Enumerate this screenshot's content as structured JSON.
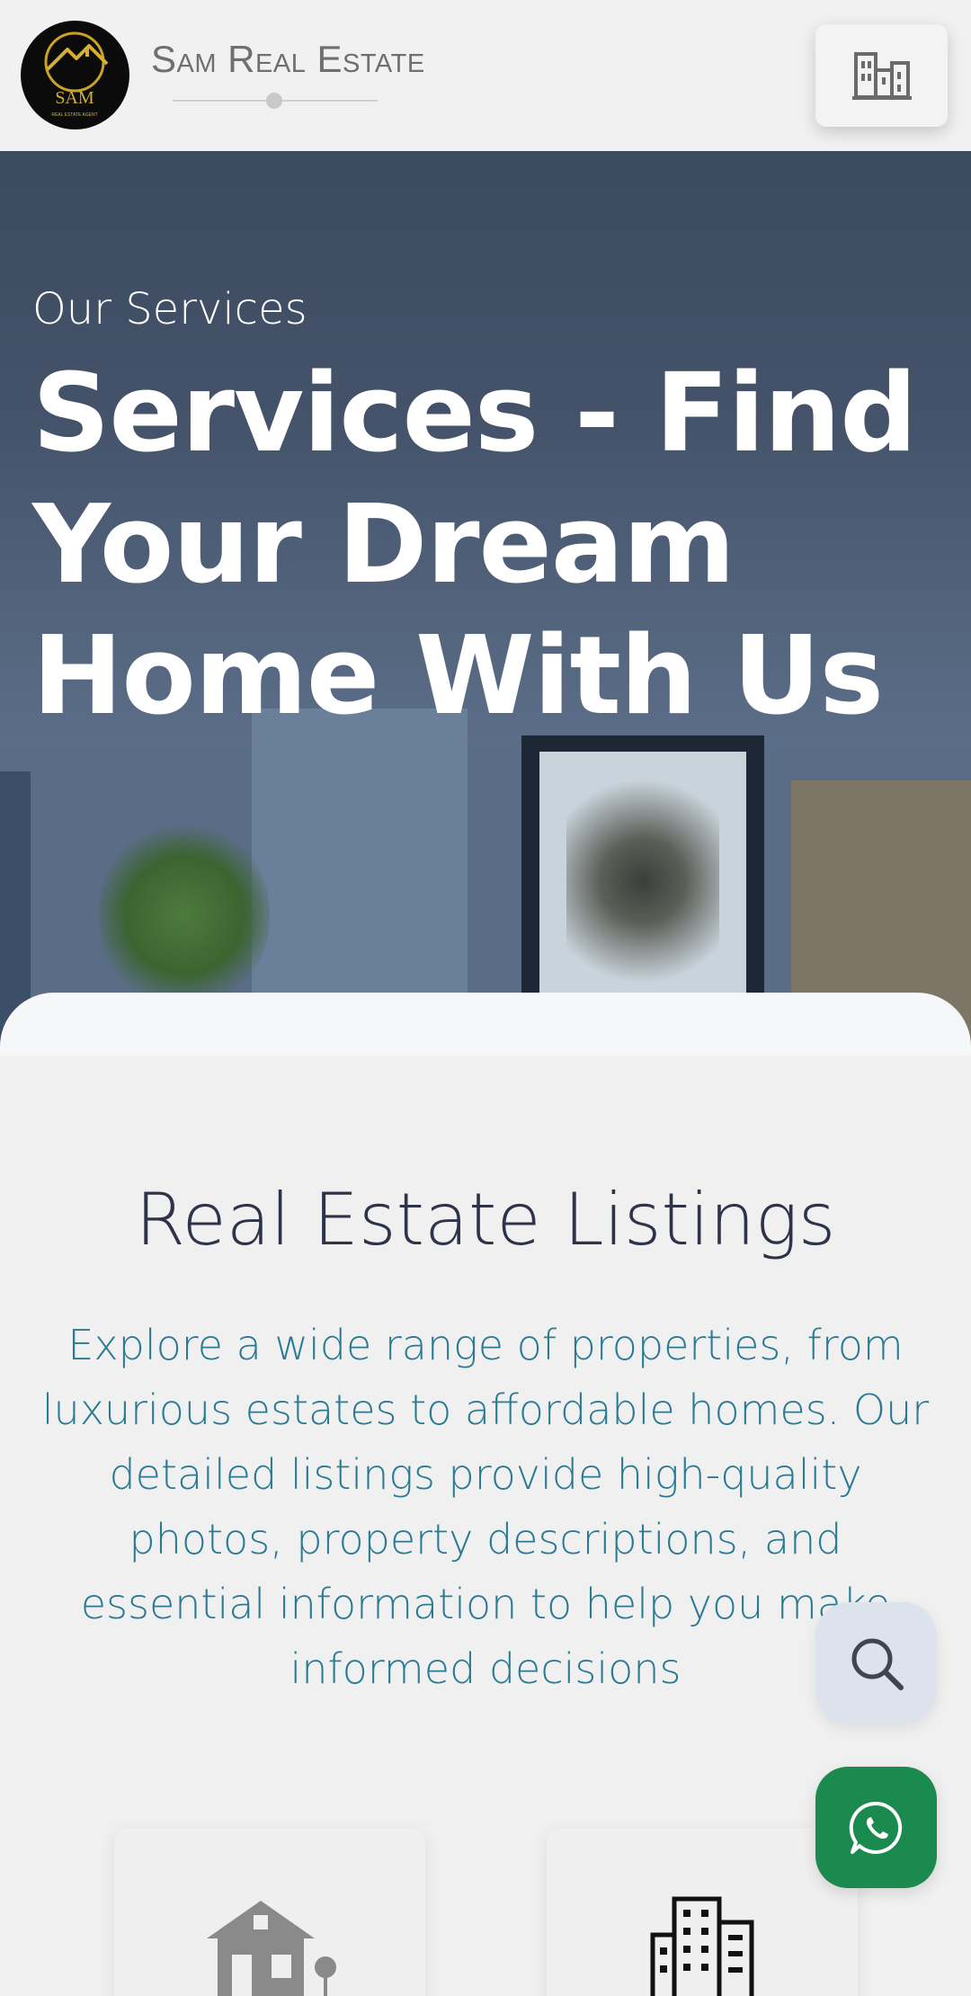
{
  "header": {
    "brand_name": "Sam Real Estate",
    "logo_icon": "house-roof-logo",
    "logo_text": "SAM",
    "logo_subtext": "REAL ESTATE AGENT",
    "menu_icon": "buildings-icon"
  },
  "hero": {
    "subtitle": "Our Services",
    "title": "Services - Find Your Dream Home With Us"
  },
  "listings": {
    "title": "Real Estate Listings",
    "description": "Explore a wide range of properties, from luxurious estates to affordable homes. Our detailed listings provide high-quality photos, property descriptions, and essential information to help you make informed decisions"
  },
  "floating": {
    "search_icon": "search-icon",
    "whatsapp_icon": "whatsapp-icon"
  },
  "cards": [
    {
      "icon": "house-icon"
    },
    {
      "icon": "apartment-building-icon"
    }
  ],
  "colors": {
    "header_bg": "#f1f1f1",
    "hero_overlay": "#3c4a5e",
    "section_title": "#2e3349",
    "section_text": "#2a7a93",
    "whatsapp_green": "#1a8a4e",
    "search_bg": "#dce3ec"
  }
}
